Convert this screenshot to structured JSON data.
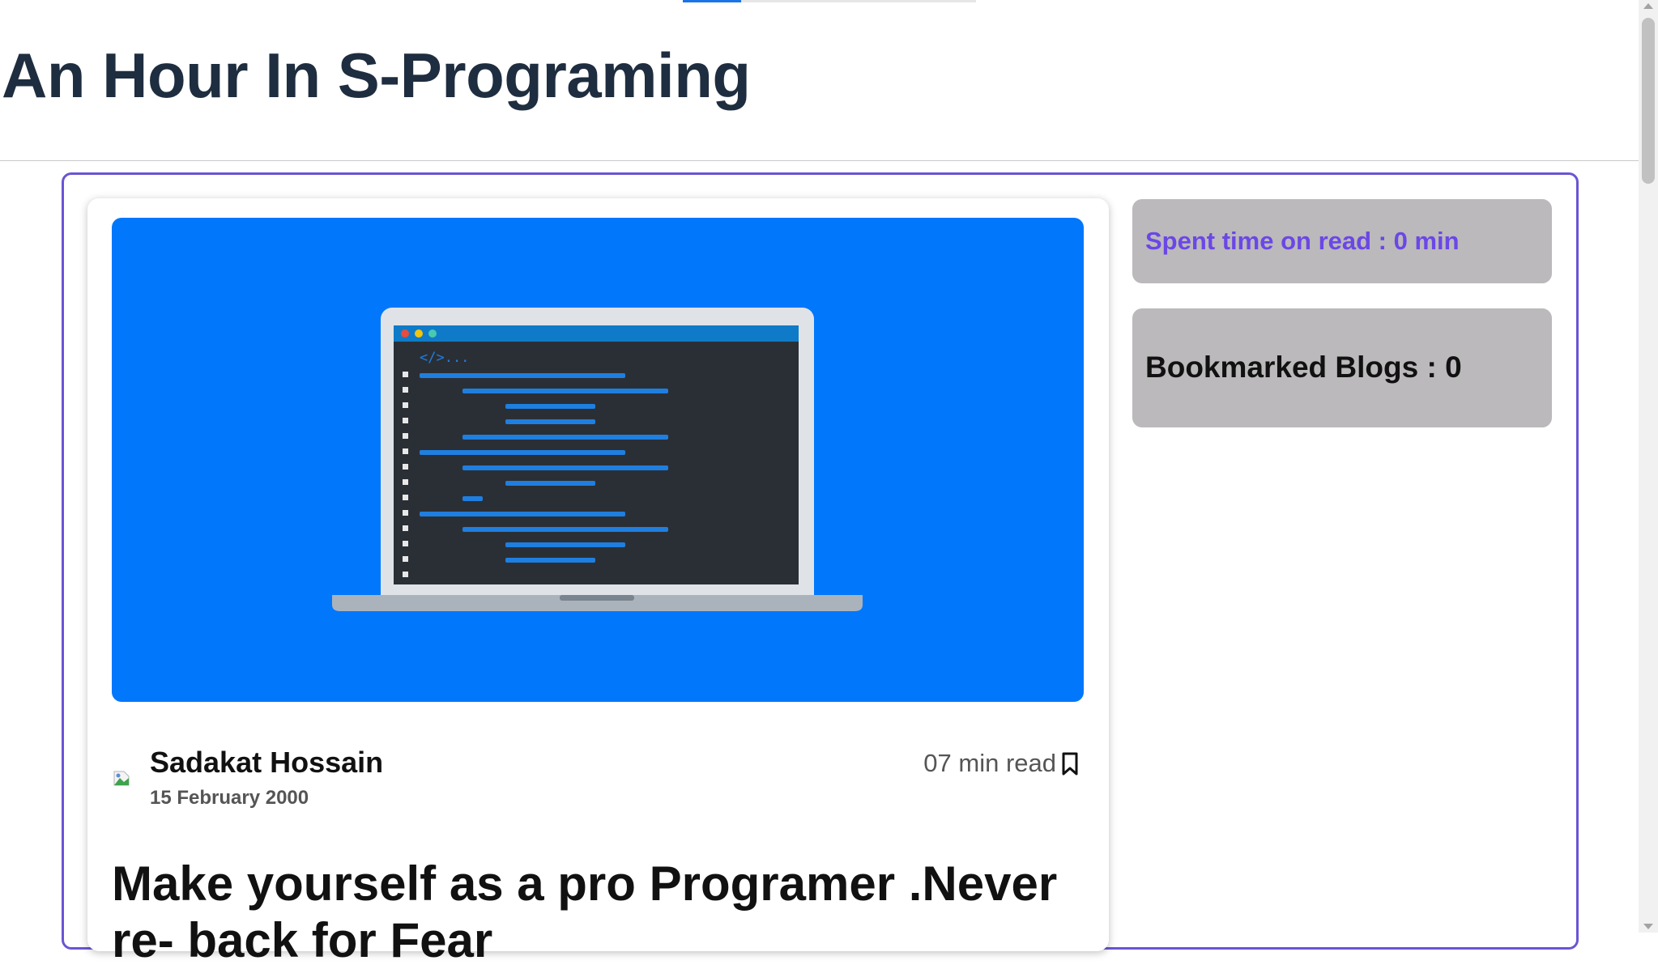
{
  "header": {
    "title": "An Hour In S-Programing"
  },
  "blog": {
    "cover_image": "laptop-code-illustration",
    "author_name": "Sadakat Hossain",
    "published_date": "15 February 2000",
    "read_time": "07 min read",
    "title": "Make yourself as a pro Programer .Never re- back for Fear"
  },
  "sidebar": {
    "spent_time": "Spent time on read : 0 min",
    "bookmarked": "Bookmarked Blogs : 0"
  },
  "colors": {
    "cover_bg": "#0177fc",
    "accent": "#6a55d4",
    "spent_text": "#6b47e6",
    "side_box_bg": "#bbb9bb",
    "title_text": "#1e2d3f"
  }
}
